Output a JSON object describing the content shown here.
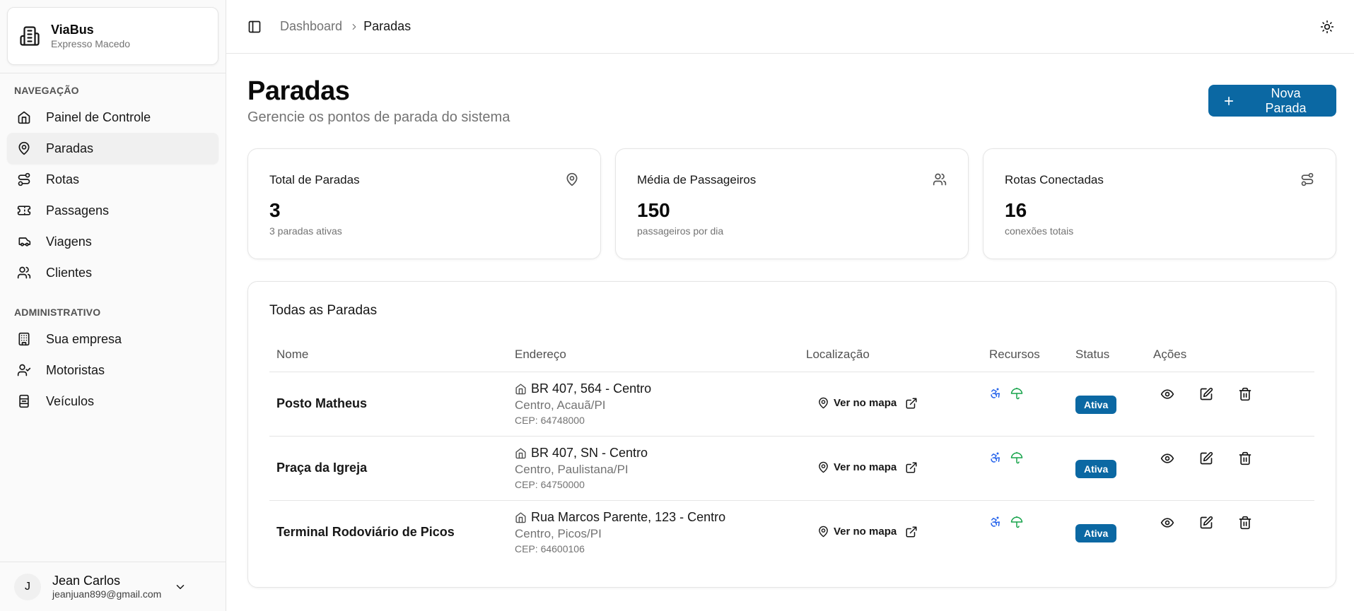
{
  "brand": {
    "name": "ViaBus",
    "company": "Expresso Macedo"
  },
  "sidebar": {
    "nav_label": "NAVEGAÇÃO",
    "nav_items": [
      {
        "label": "Painel de Controle",
        "icon": "home-icon"
      },
      {
        "label": "Paradas",
        "icon": "map-pin-icon",
        "active": true
      },
      {
        "label": "Rotas",
        "icon": "route-icon"
      },
      {
        "label": "Passagens",
        "icon": "ticket-icon"
      },
      {
        "label": "Viagens",
        "icon": "bus-icon"
      },
      {
        "label": "Clientes",
        "icon": "users-icon"
      }
    ],
    "admin_label": "ADMINISTRATIVO",
    "admin_items": [
      {
        "label": "Sua empresa",
        "icon": "building-icon"
      },
      {
        "label": "Motoristas",
        "icon": "user-check-icon"
      },
      {
        "label": "Veículos",
        "icon": "truck-icon"
      }
    ]
  },
  "user": {
    "initial": "J",
    "name": "Jean Carlos",
    "email": "jeanjuan899@gmail.com"
  },
  "breadcrumb": {
    "parent": "Dashboard",
    "current": "Paradas"
  },
  "page": {
    "title": "Paradas",
    "subtitle": "Gerencie os pontos de parada do sistema",
    "new_button": "Nova Parada"
  },
  "stats": [
    {
      "title": "Total de Paradas",
      "value": "3",
      "desc": "3 paradas ativas",
      "icon": "map-pin-icon"
    },
    {
      "title": "Média de Passageiros",
      "value": "150",
      "desc": "passageiros por dia",
      "icon": "users-icon"
    },
    {
      "title": "Rotas Conectadas",
      "value": "16",
      "desc": "conexões totais",
      "icon": "route-icon"
    }
  ],
  "table": {
    "title": "Todas as Paradas",
    "columns": [
      "Nome",
      "Endereço",
      "Localização",
      "Recursos",
      "Status",
      "Ações"
    ],
    "rows": [
      {
        "name": "Posto Matheus",
        "street": "BR 407, 564 - Centro",
        "city": "Centro, Acauã/PI",
        "cep": "CEP: 64748000",
        "map_link": "Ver no mapa",
        "status": "Ativa"
      },
      {
        "name": "Praça da Igreja",
        "street": "BR 407, SN - Centro",
        "city": "Centro, Paulistana/PI",
        "cep": "CEP: 64750000",
        "map_link": "Ver no mapa",
        "status": "Ativa"
      },
      {
        "name": "Terminal Rodoviário de Picos",
        "street": "Rua Marcos Parente, 123 - Centro",
        "city": "Centro, Picos/PI",
        "cep": "CEP: 64600106",
        "map_link": "Ver no mapa",
        "status": "Ativa"
      }
    ]
  },
  "colors": {
    "primary": "#0b68a3",
    "accessibility": "#2563eb",
    "shelter": "#16a34a"
  }
}
